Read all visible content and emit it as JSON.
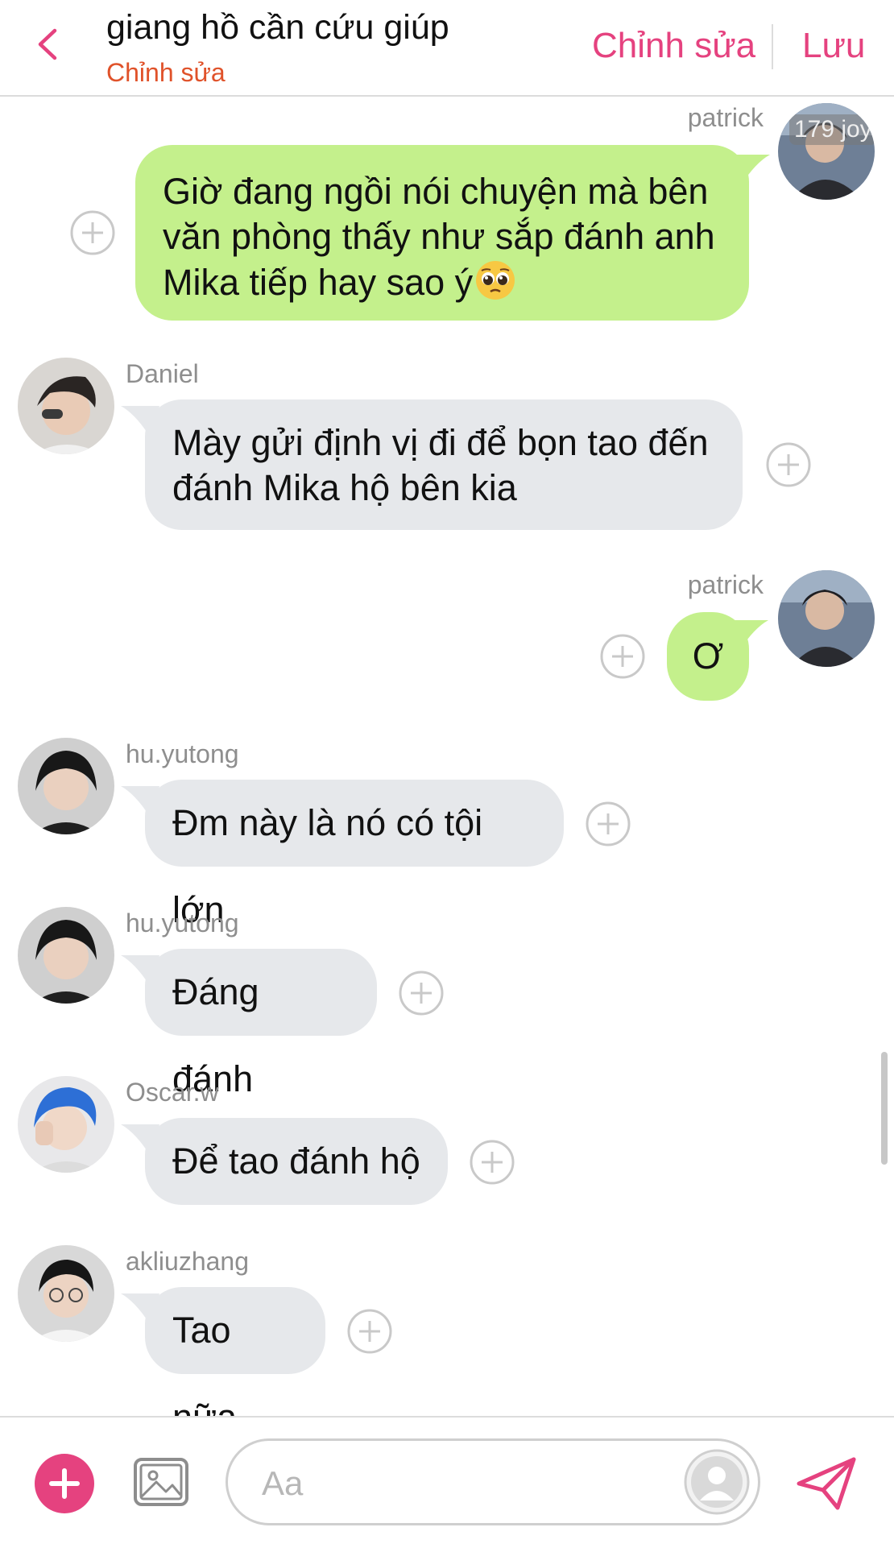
{
  "header": {
    "title": "giang hồ cần cứu giúp",
    "subtitle": "Chỉnh sửa",
    "edit_label": "Chỉnh sửa",
    "save_label": "Lưu"
  },
  "colors": {
    "accent": "#e5427f",
    "subtitle": "#e0522a",
    "outgoing_bubble": "#c4f08c",
    "incoming_bubble": "#e6e8eb"
  },
  "messages": [
    {
      "sender": "patrick",
      "direction": "outgoing",
      "lines": [
        "Giờ đang ngồi nói chuyện mà bên",
        "văn phòng thấy như sắp đánh anh",
        "Mika tiếp hay sao ý"
      ],
      "emoji": "pleading-face-emoji",
      "avatar_overlay": "179 joy"
    },
    {
      "sender": "Daniel",
      "direction": "incoming",
      "lines": [
        "Mày gửi định vị đi để bọn tao đến",
        "đánh Mika hộ bên kia"
      ]
    },
    {
      "sender": "patrick",
      "direction": "outgoing",
      "lines": [
        "Ơ"
      ]
    },
    {
      "sender": "hu.yutong",
      "direction": "incoming",
      "lines": [
        "Đm này là nó có tội lớn"
      ]
    },
    {
      "sender": "hu.yutong",
      "direction": "incoming",
      "lines": [
        "Đáng đánh"
      ]
    },
    {
      "sender": "Oscar.w",
      "direction": "incoming",
      "lines": [
        "Để tao đánh hộ"
      ]
    },
    {
      "sender": "akliuzhang",
      "direction": "incoming",
      "lines": [
        "Tao nữa"
      ]
    }
  ],
  "composer": {
    "placeholder": "Aa"
  },
  "icons": {
    "back": "chevron-left-icon",
    "add_reaction": "plus-circle-icon",
    "add": "plus-icon",
    "image": "image-icon",
    "profile": "person-icon",
    "send": "send-icon"
  }
}
